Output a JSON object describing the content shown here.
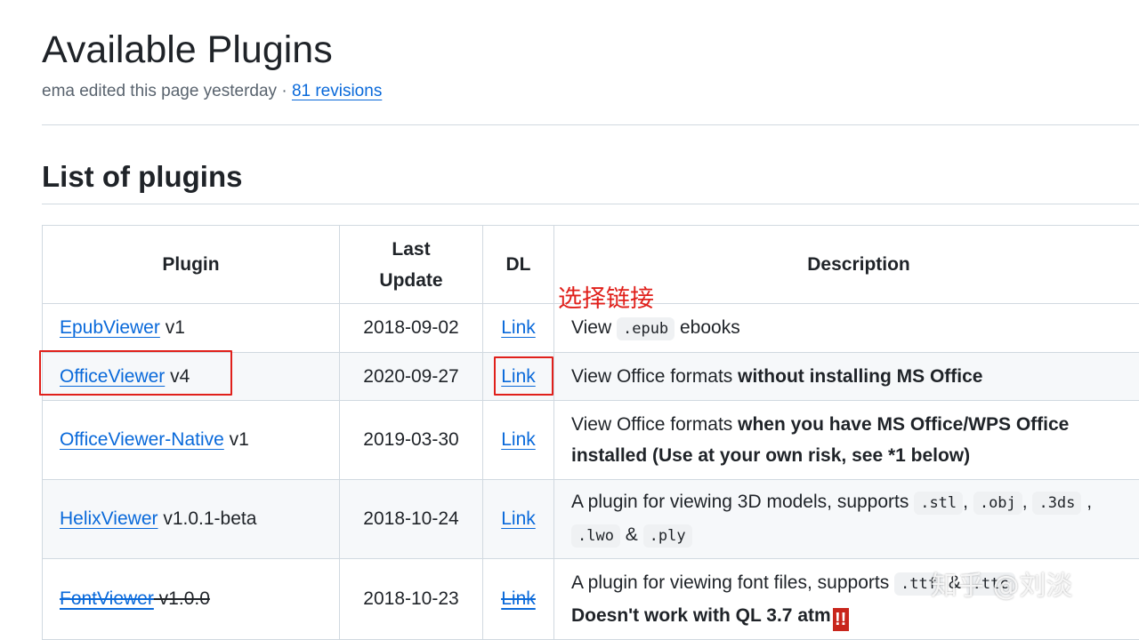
{
  "page": {
    "title": "Available Plugins",
    "editor_text": "ema edited this page yesterday · ",
    "revisions_link": "81 revisions",
    "section_title": "List of plugins"
  },
  "table": {
    "headers": {
      "plugin": "Plugin",
      "last_update_line1": "Last",
      "last_update_line2": "Update",
      "dl": "DL",
      "description": "Description"
    },
    "rows": [
      {
        "name": "EpubViewer",
        "version": " v1",
        "date": "2018-09-02",
        "dl": "Link",
        "desc_a": "View ",
        "code_a": ".epub",
        "desc_b": " ebooks"
      },
      {
        "name": "OfficeViewer",
        "version": " v4",
        "date": "2020-09-27",
        "dl": "Link",
        "desc_a": "View Office formats ",
        "desc_bold": "without installing MS Office"
      },
      {
        "name": "OfficeViewer-Native",
        "version": " v1",
        "date": "2019-03-30",
        "dl": "Link",
        "desc_a": "View Office formats ",
        "desc_bold": "when you have MS Office/WPS Office",
        "desc_bold2": "installed (Use at your own risk, see *1 below)"
      },
      {
        "name": "HelixViewer",
        "version": " v1.0.1-beta",
        "date": "2018-10-24",
        "dl": "Link",
        "desc_a": "A plugin for viewing 3D models, supports ",
        "code_a": ".stl",
        "sep1": ", ",
        "code_b": ".obj",
        "sep2": ", ",
        "code_c": ".3ds",
        "sep3": " ,",
        "code_d": ".lwo",
        "amp": " & ",
        "code_e": ".ply"
      },
      {
        "name": "FontViewer",
        "version": " v1.0.0",
        "date": "2018-10-23",
        "dl": "Link",
        "desc_a": "A plugin for viewing font files, supports ",
        "code_a": ".ttf",
        "amp": " & ",
        "code_b": ".ttc",
        "desc_bold": "Doesn't work with QL 3.7 atm",
        "bang": "!!"
      }
    ]
  },
  "annotation": {
    "note": "选择链接"
  },
  "watermark": "知乎 @刘淡",
  "colors": {
    "link": "#0969da",
    "highlight": "#e0201b",
    "border": "#d1d9e0"
  }
}
